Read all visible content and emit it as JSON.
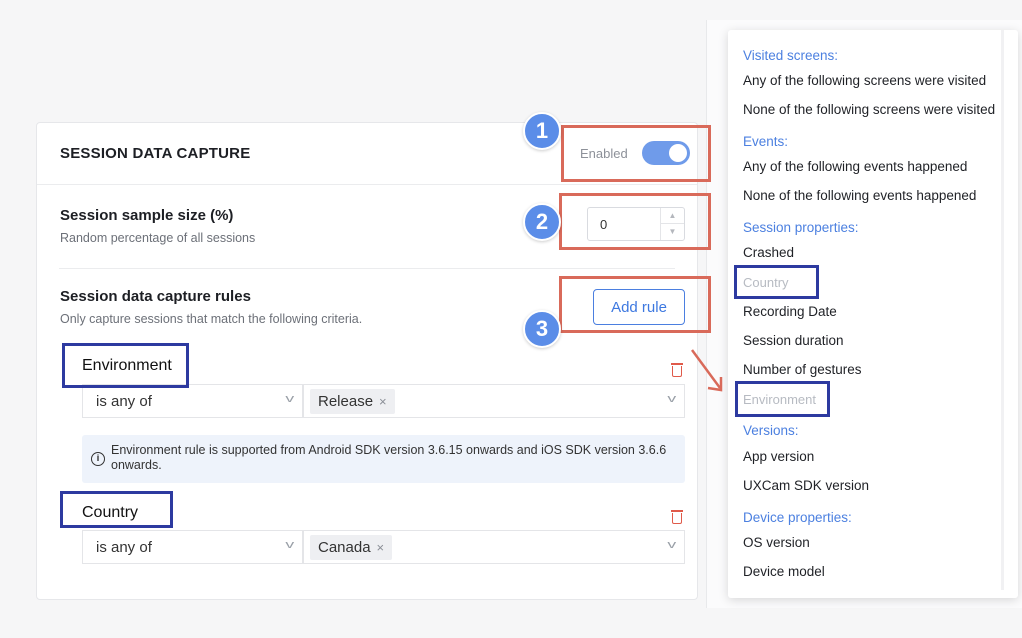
{
  "card": {
    "title": "SESSION DATA CAPTURE",
    "toggle_label": "Enabled",
    "toggle_on": true
  },
  "sample_size": {
    "title": "Session sample size (%)",
    "subtitle": "Random percentage of all sessions",
    "value": "0",
    "spin_up": "▲",
    "spin_down": "▼"
  },
  "rules": {
    "title": "Session data capture rules",
    "subtitle": "Only capture sessions that match the following criteria.",
    "add_rule_label": "Add rule",
    "items": [
      {
        "label": "Environment",
        "operator": "is any of",
        "value": "Release",
        "remove": "×"
      },
      {
        "label": "Country",
        "operator": "is any of",
        "value": "Canada",
        "remove": "×"
      }
    ],
    "info_icon": "i",
    "info_text": "Environment rule is supported from Android SDK version 3.6.15 onwards and iOS SDK version 3.6.6 onwards."
  },
  "chevron": "v",
  "badges": [
    "1",
    "2",
    "3"
  ],
  "dropdown": {
    "visited_screens_header": "Visited screens:",
    "visited_screens": [
      "Any of the following screens were visited",
      "None of the following screens were visited"
    ],
    "events_header": "Events:",
    "events": [
      "Any of the following events happened",
      "None of the following events happened"
    ],
    "session_properties_header": "Session properties:",
    "session_properties": [
      "Crashed",
      "Country",
      "Recording Date",
      "Session duration",
      "Number of gestures",
      "Environment"
    ],
    "versions_header": "Versions:",
    "versions": [
      "App version",
      "UXCam SDK version"
    ],
    "device_properties_header": "Device properties:",
    "device_properties": [
      "OS version",
      "Device model"
    ]
  },
  "colors": {
    "accent": "#4c80e0",
    "toggle": "#6f9bea",
    "annotation_red": "#d96a5a",
    "annotation_blue": "#2d3aa0",
    "badge": "#5b8de8"
  }
}
